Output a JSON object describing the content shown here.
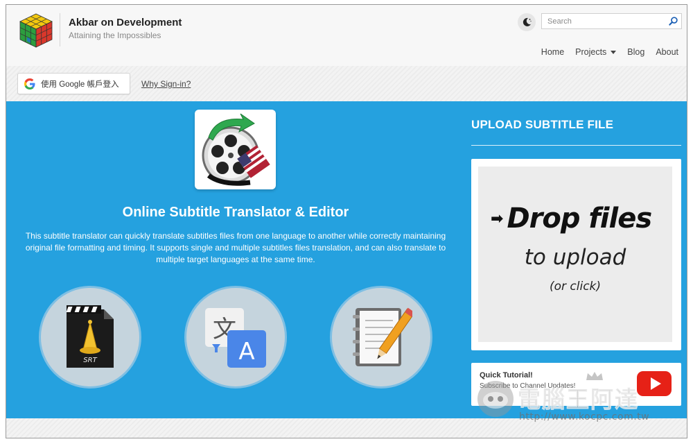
{
  "header": {
    "site_title": "Akbar on Development",
    "site_tagline": "Attaining the Impossibles",
    "search": {
      "placeholder": "Search",
      "value": ""
    },
    "nav": [
      {
        "label": "Home"
      },
      {
        "label": "Projects",
        "has_dropdown": true
      },
      {
        "label": "Blog"
      },
      {
        "label": "About"
      }
    ]
  },
  "signin": {
    "google_button": "使用 Google 帳戶登入",
    "why_link": "Why Sign-in?"
  },
  "hero": {
    "title": "Online Subtitle Translator & Editor",
    "description": "This subtitle translator can quickly translate subtitles files from one language to another while correctly maintaining original file formatting and timing. It supports single and multiple subtitles files translation, and can also translate to multiple target languages at the same time."
  },
  "features": [
    {
      "icon": "srt-file-icon",
      "label": "SRT"
    },
    {
      "icon": "google-translate-icon",
      "label_source": "文",
      "label_target": "A"
    },
    {
      "icon": "notebook-pencil-icon"
    }
  ],
  "upload": {
    "heading": "UPLOAD SUBTITLE FILE",
    "drop_line1": "Drop files",
    "drop_line2": "to upload",
    "drop_line3": "(or click)"
  },
  "tutorial": {
    "title": "Quick Tutorial!",
    "subtitle": "Subscribe to Channel Updates!"
  },
  "watermark": {
    "text": "電腦王阿達",
    "url": "http://www.kocpc.com.tw"
  },
  "colors": {
    "main_blue": "#25a1df",
    "header_bg": "#f7f7f7",
    "youtube_red": "#e62117"
  }
}
